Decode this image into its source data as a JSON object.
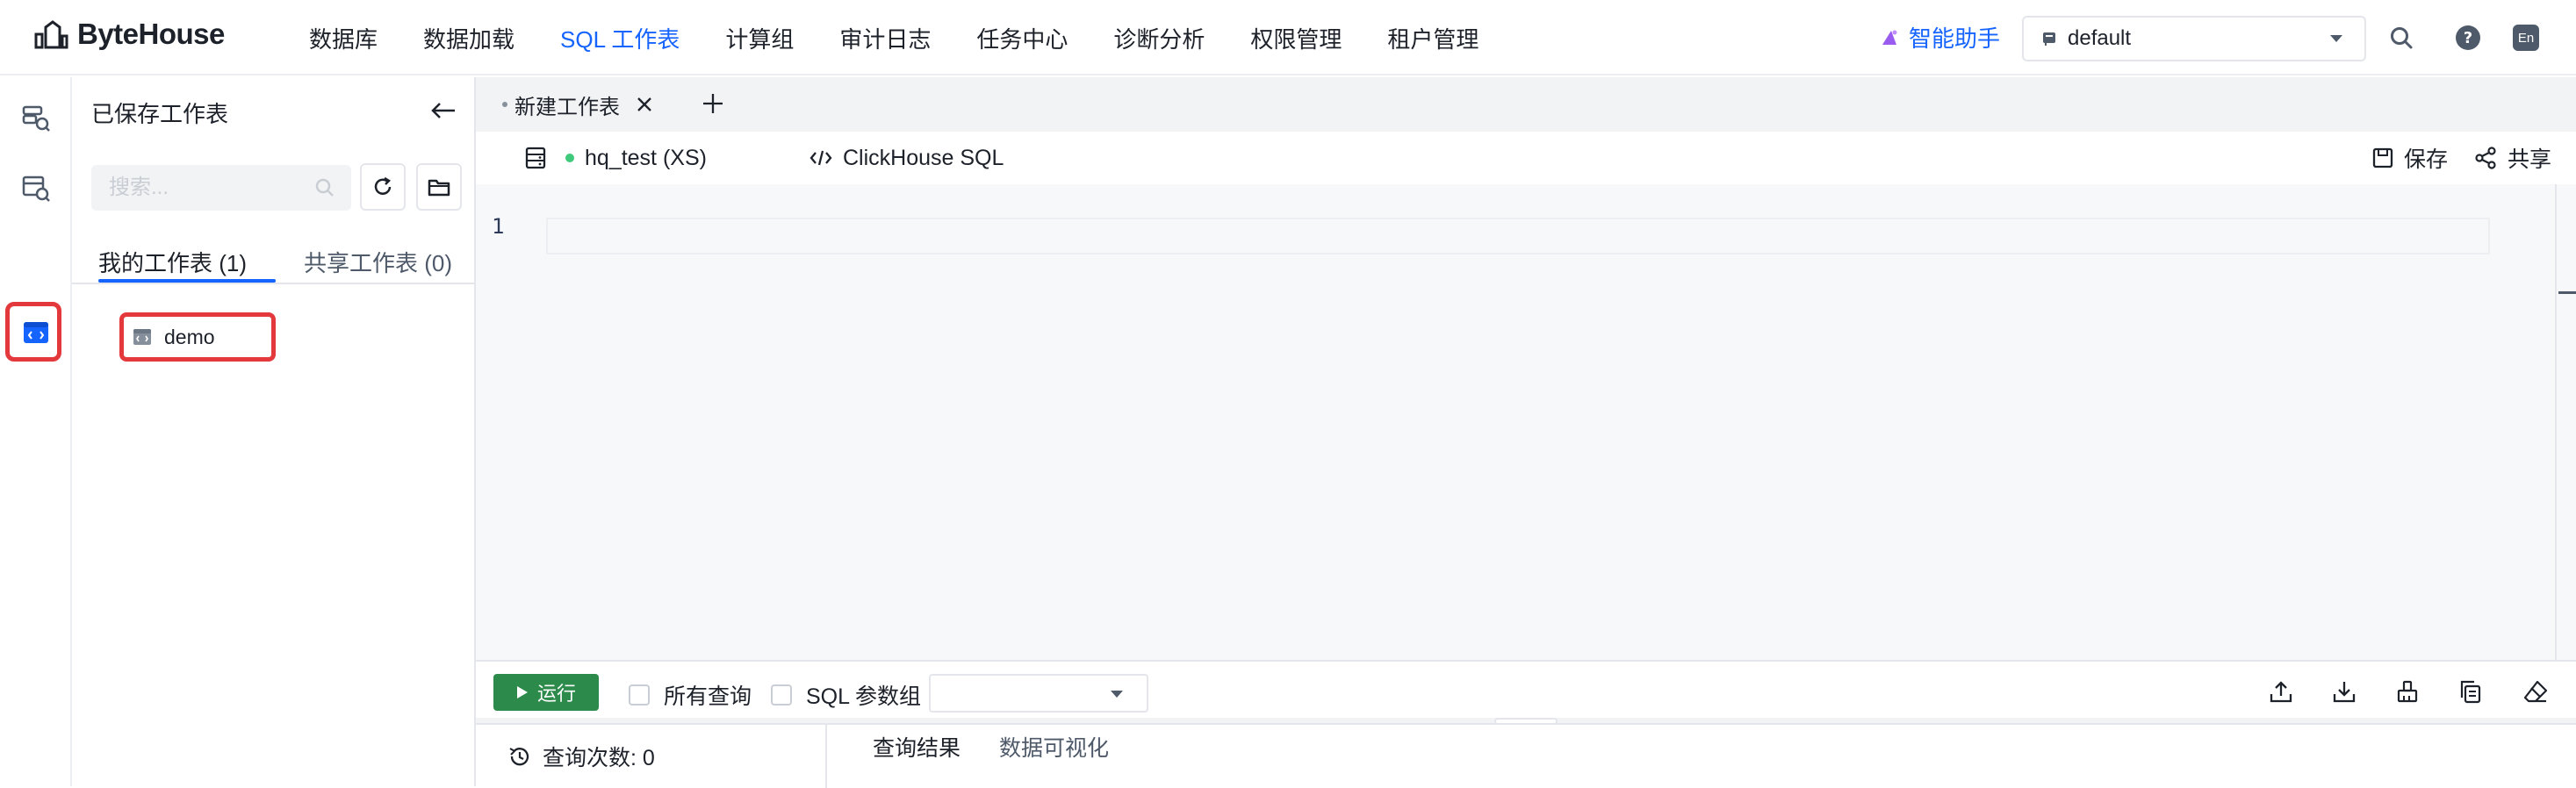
{
  "app": {
    "name": "ByteHouse"
  },
  "nav": {
    "items": [
      "数据库",
      "数据加载",
      "SQL 工作表",
      "计算组",
      "审计日志",
      "任务中心",
      "诊断分析",
      "权限管理",
      "租户管理"
    ],
    "active_index": 2
  },
  "header": {
    "assistant_label": "智能助手",
    "database_value": "default",
    "lang_label": "En"
  },
  "sidebar": {
    "title": "已保存工作表",
    "search_placeholder": "搜索...",
    "tabs": [
      {
        "label": "我的工作表 (1)",
        "active": true
      },
      {
        "label": "共享工作表 (0)",
        "active": false
      }
    ],
    "files": [
      {
        "name": "demo"
      }
    ]
  },
  "worksheet": {
    "tab_label": "新建工作表",
    "cluster": "hq_test (XS)",
    "dialect": "ClickHouse SQL",
    "save_label": "保存",
    "share_label": "共享",
    "line_numbers": [
      "1"
    ]
  },
  "run_bar": {
    "run_label": "运行",
    "all_queries_label": "所有查询",
    "param_group_label": "SQL 参数组",
    "param_group_value": ""
  },
  "results": {
    "query_count_label": "查询次数: 0",
    "tabs": [
      "查询结果",
      "数据可视化"
    ]
  },
  "colors": {
    "accent": "#1664ff",
    "run_button": "#2c8a4a",
    "highlight": "#e4393c",
    "status_online": "#3fc97a"
  },
  "icons": {
    "rail": [
      "database-search-icon",
      "table-search-icon",
      "worksheet-icon"
    ],
    "toolbar_actions": [
      "upload-icon",
      "download-icon",
      "format-icon",
      "copy-icon",
      "clear-icon"
    ]
  }
}
